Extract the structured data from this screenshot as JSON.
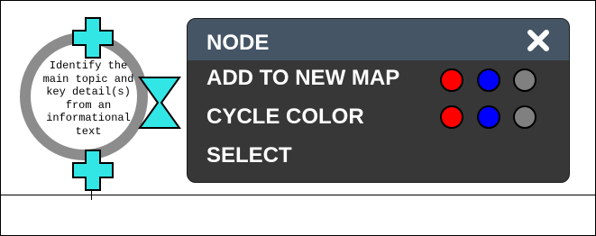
{
  "node": {
    "text_lines": [
      "Identify the",
      "main topic and",
      "key detail(s)",
      "from an",
      "informational",
      "text"
    ]
  },
  "menu": {
    "title": "NODE",
    "close_icon": "close-icon",
    "items": [
      {
        "label": "ADD TO NEW MAP",
        "colors": [
          "#ff0000",
          "#0000ff",
          "#808080"
        ]
      },
      {
        "label": "CYCLE COLOR",
        "colors": [
          "#ff0000",
          "#0000ff",
          "#808080"
        ]
      },
      {
        "label": "SELECT"
      }
    ]
  },
  "colors": {
    "accent": "#33e6e6",
    "menu_background": "#373737",
    "menu_header": "#455565",
    "node_ring": "#8c8c8c"
  }
}
